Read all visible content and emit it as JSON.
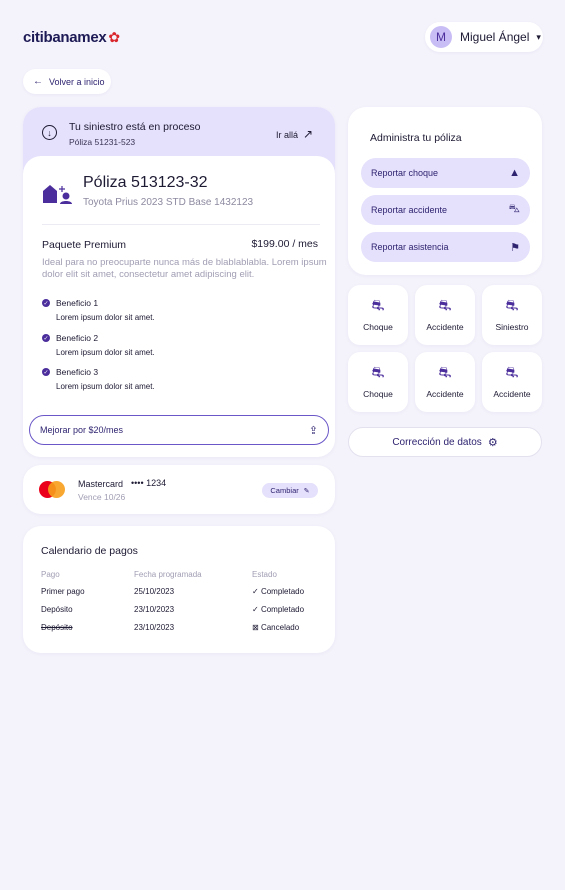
{
  "header": {
    "logo_text": "citibanamex",
    "avatar_initial": "M",
    "user_name": "Miguel Ángel"
  },
  "back_label": "Volver a inicio",
  "status": {
    "title": "Tu siniestro está en proceso",
    "subtitle": "Póliza 51231-523",
    "goto_label": "Ir allá"
  },
  "policy": {
    "title": "Póliza 513123-32",
    "vehicle": "Toyota Prius 2023 STD Base 1432123",
    "package_name": "Paquete Premium",
    "package_price": "$199.00  / mes",
    "package_desc": "Ideal para no preocuparte nunca más de blablablabla. Lorem ipsum dolor elit sit amet, consectetur amet adipiscing elit.",
    "benefits": [
      {
        "title": "Beneficio 1",
        "desc": "Lorem ipsum dolor sit amet."
      },
      {
        "title": "Beneficio 2",
        "desc": "Lorem ipsum dolor sit amet."
      },
      {
        "title": "Beneficio 3",
        "desc": "Lorem ipsum dolor sit amet."
      }
    ],
    "upgrade_label": "Mejorar por $20/mes"
  },
  "payment": {
    "brand": "Mastercard",
    "number": "•••• 1234",
    "expiry": "Vence 10/26",
    "change_label": "Cambiar"
  },
  "calendar": {
    "title": "Calendario de pagos",
    "headers": [
      "Pago",
      "Fecha programada",
      "Estado"
    ],
    "rows": [
      {
        "pago": "Primer pago",
        "fecha": "25/10/2023",
        "estado": "Completado",
        "icon": "✓"
      },
      {
        "pago": "Depósito",
        "fecha": "23/10/2023",
        "estado": "Completado",
        "icon": "✓"
      },
      {
        "pago": "Depósito",
        "fecha": "23/10/2023",
        "estado": "Cancelado",
        "icon": "⊠"
      }
    ]
  },
  "admin": {
    "title": "Administra tu póliza",
    "actions": [
      {
        "label": "Reportar choque",
        "icon": "warning-icon"
      },
      {
        "label": "Reportar accidente",
        "icon": "car-alert-icon"
      },
      {
        "label": "Reportar asistencia",
        "icon": "flag-icon"
      }
    ]
  },
  "tiles": [
    "Choque",
    "Accidente",
    "Siniestro",
    "Choque",
    "Accidente",
    "Accidente"
  ],
  "correction_label": "Corrección de datos",
  "colors": {
    "background": "#f4f3fb",
    "accent": "#4b2e9c",
    "accent_light": "#e5e0fb",
    "brand_red": "#d9262c"
  }
}
